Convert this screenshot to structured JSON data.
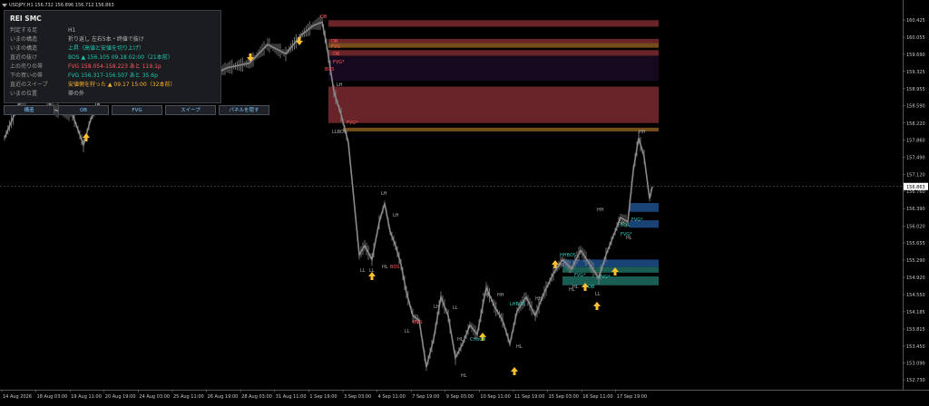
{
  "window": {
    "symbol_line": "USDJPY,H1  156.732 156.896 156.712 156.863"
  },
  "panel": {
    "title": "REI SMC",
    "rows": [
      {
        "label": "判定する足",
        "value": "H1",
        "color": "gray"
      },
      {
        "label": "いまの構造",
        "value": "折り返し 左右5本・终値で抜け",
        "color": "gray"
      },
      {
        "label": "いまの構造",
        "value": "上昇（高値と安値を切り上げ）",
        "color": "teal"
      },
      {
        "label": "直近の抜け",
        "value": "BOS ▲ 156.105  09.18 02:00（21本前）",
        "color": "teal"
      },
      {
        "label": "上の売りの帯",
        "value": "FVG 158.054-158.223  あと 119.1p",
        "color": "red"
      },
      {
        "label": "下の買いの帯",
        "value": "FVG 156.317-156.507  あと 35.6p",
        "color": "teal"
      },
      {
        "label": "直近のスイープ",
        "value": "安値側を狩った ▲ 09.17 15:00（32本前）",
        "color": "orange"
      },
      {
        "label": "いまの位置",
        "value": "帯の外",
        "color": "gray"
      }
    ],
    "buttons": [
      "構造",
      "OB",
      "FVG",
      "スイープ",
      "パネルを隠す"
    ]
  },
  "colors": {
    "background": "#000000",
    "candle": "#8a8a8a",
    "bear_zone": "#7a2a30",
    "supply_zone": "#1a0a24",
    "ob_orange": "#8a5a20",
    "demand_teal": "#1f6d60",
    "demand_blue": "#1e4f8a",
    "arrow": "#ffc030",
    "current_price": "#ffffff"
  },
  "chart": {
    "price_ticks": [
      "160.425",
      "160.055",
      "159.690",
      "159.325",
      "158.955",
      "158.590",
      "158.220",
      "157.860",
      "157.490",
      "157.120",
      "156.760",
      "156.390",
      "156.020",
      "155.655",
      "155.290",
      "154.920",
      "154.550",
      "154.185",
      "153.815",
      "153.450",
      "153.090",
      "152.730"
    ],
    "current_price": "156.863",
    "time_ticks": [
      "14 Aug 2026",
      "18 Aug 03:00",
      "19 Aug 11:00",
      "20 Aug 19:00",
      "24 Aug 03:00",
      "25 Aug 11:00",
      "26 Aug 19:00",
      "28 Aug 03:00",
      "31 Aug 11:00",
      "1 Sep 19:00",
      "3 Sep 03:00",
      "4 Sep 11:00",
      "7 Sep 19:00",
      "9 Sep 03:00",
      "10 Sep 11:00",
      "11 Sep 19:00",
      "15 Sep 03:00",
      "16 Sep 11:00",
      "17 Sep 19:00"
    ],
    "structure_labels": [
      {
        "t": "OB",
        "c": "red"
      },
      {
        "t": "OB",
        "c": "red"
      },
      {
        "t": "FVG",
        "c": "red"
      },
      {
        "t": "OB",
        "c": "red"
      },
      {
        "t": "FVG*",
        "c": "red"
      },
      {
        "t": "BOS",
        "c": "red"
      },
      {
        "t": "LH",
        "c": "gray"
      },
      {
        "t": "FVG*",
        "c": "red"
      },
      {
        "t": "LLBOS",
        "c": "gray"
      },
      {
        "t": "LH",
        "c": "gray"
      },
      {
        "t": "LH",
        "c": "gray"
      },
      {
        "t": "LL",
        "c": "gray"
      },
      {
        "t": "LL",
        "c": "gray"
      },
      {
        "t": "HL",
        "c": "gray"
      },
      {
        "t": "BOS",
        "c": "red"
      },
      {
        "t": "BOS",
        "c": "red"
      },
      {
        "t": "LL",
        "c": "gray"
      },
      {
        "t": "LH",
        "c": "gray"
      },
      {
        "t": "LL",
        "c": "gray"
      },
      {
        "t": "HH",
        "c": "gray"
      },
      {
        "t": "HL",
        "c": "gray"
      },
      {
        "t": "HL",
        "c": "gray"
      },
      {
        "t": "CHoCH",
        "c": "teal"
      },
      {
        "t": "HH",
        "c": "gray"
      },
      {
        "t": "LHBOS",
        "c": "teal"
      },
      {
        "t": "HL",
        "c": "gray"
      },
      {
        "t": "HH",
        "c": "gray"
      },
      {
        "t": "HHBOS",
        "c": "teal"
      },
      {
        "t": "HL",
        "c": "gray"
      },
      {
        "t": "FVG*",
        "c": "teal"
      },
      {
        "t": "OB",
        "c": "teal"
      },
      {
        "t": "HL",
        "c": "gray"
      },
      {
        "t": "HH",
        "c": "gray"
      },
      {
        "t": "FVG*",
        "c": "teal"
      },
      {
        "t": "HH",
        "c": "gray"
      },
      {
        "t": "HL",
        "c": "gray"
      },
      {
        "t": "BOS",
        "c": "teal"
      },
      {
        "t": "FVG*",
        "c": "teal"
      },
      {
        "t": "HH",
        "c": "gray"
      },
      {
        "t": "FVG*",
        "c": "teal"
      },
      {
        "t": "HL",
        "c": "gray"
      },
      {
        "t": "LL",
        "c": "gray"
      }
    ]
  }
}
